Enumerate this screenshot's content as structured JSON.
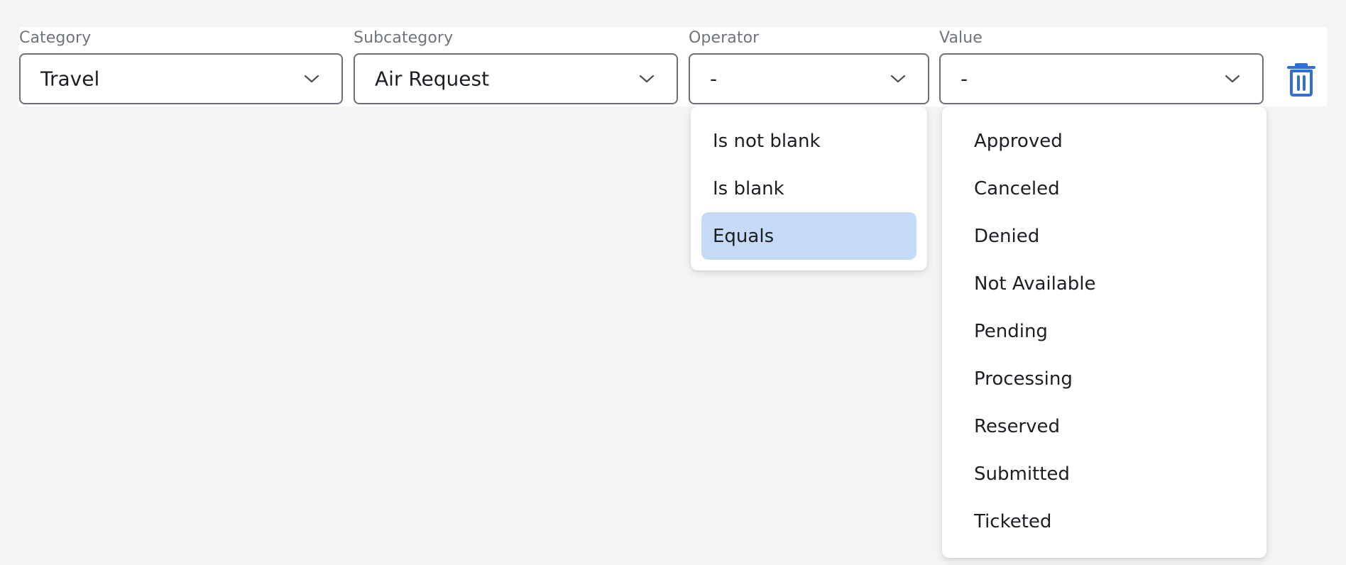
{
  "filters": {
    "category": {
      "label": "Category",
      "value": "Travel"
    },
    "subcategory": {
      "label": "Subcategory",
      "value": "Air Request"
    },
    "operator": {
      "label": "Operator",
      "value": "-"
    },
    "value": {
      "label": "Value",
      "value": "-"
    }
  },
  "operator_menu": {
    "options": [
      "Is not blank",
      "Is blank",
      "Equals"
    ],
    "selected": "Equals"
  },
  "value_menu": {
    "options": [
      "Approved",
      "Canceled",
      "Denied",
      "Not Available",
      "Pending",
      "Processing",
      "Reserved",
      "Submitted",
      "Ticketed"
    ]
  },
  "icons": {
    "chevron": "chevron-down-icon",
    "delete": "trash-icon"
  },
  "colors": {
    "background": "#f4f4f4",
    "selected_option": "#c5daf5",
    "delete_icon": "#2f6fd8",
    "label_text": "#6f747b"
  }
}
